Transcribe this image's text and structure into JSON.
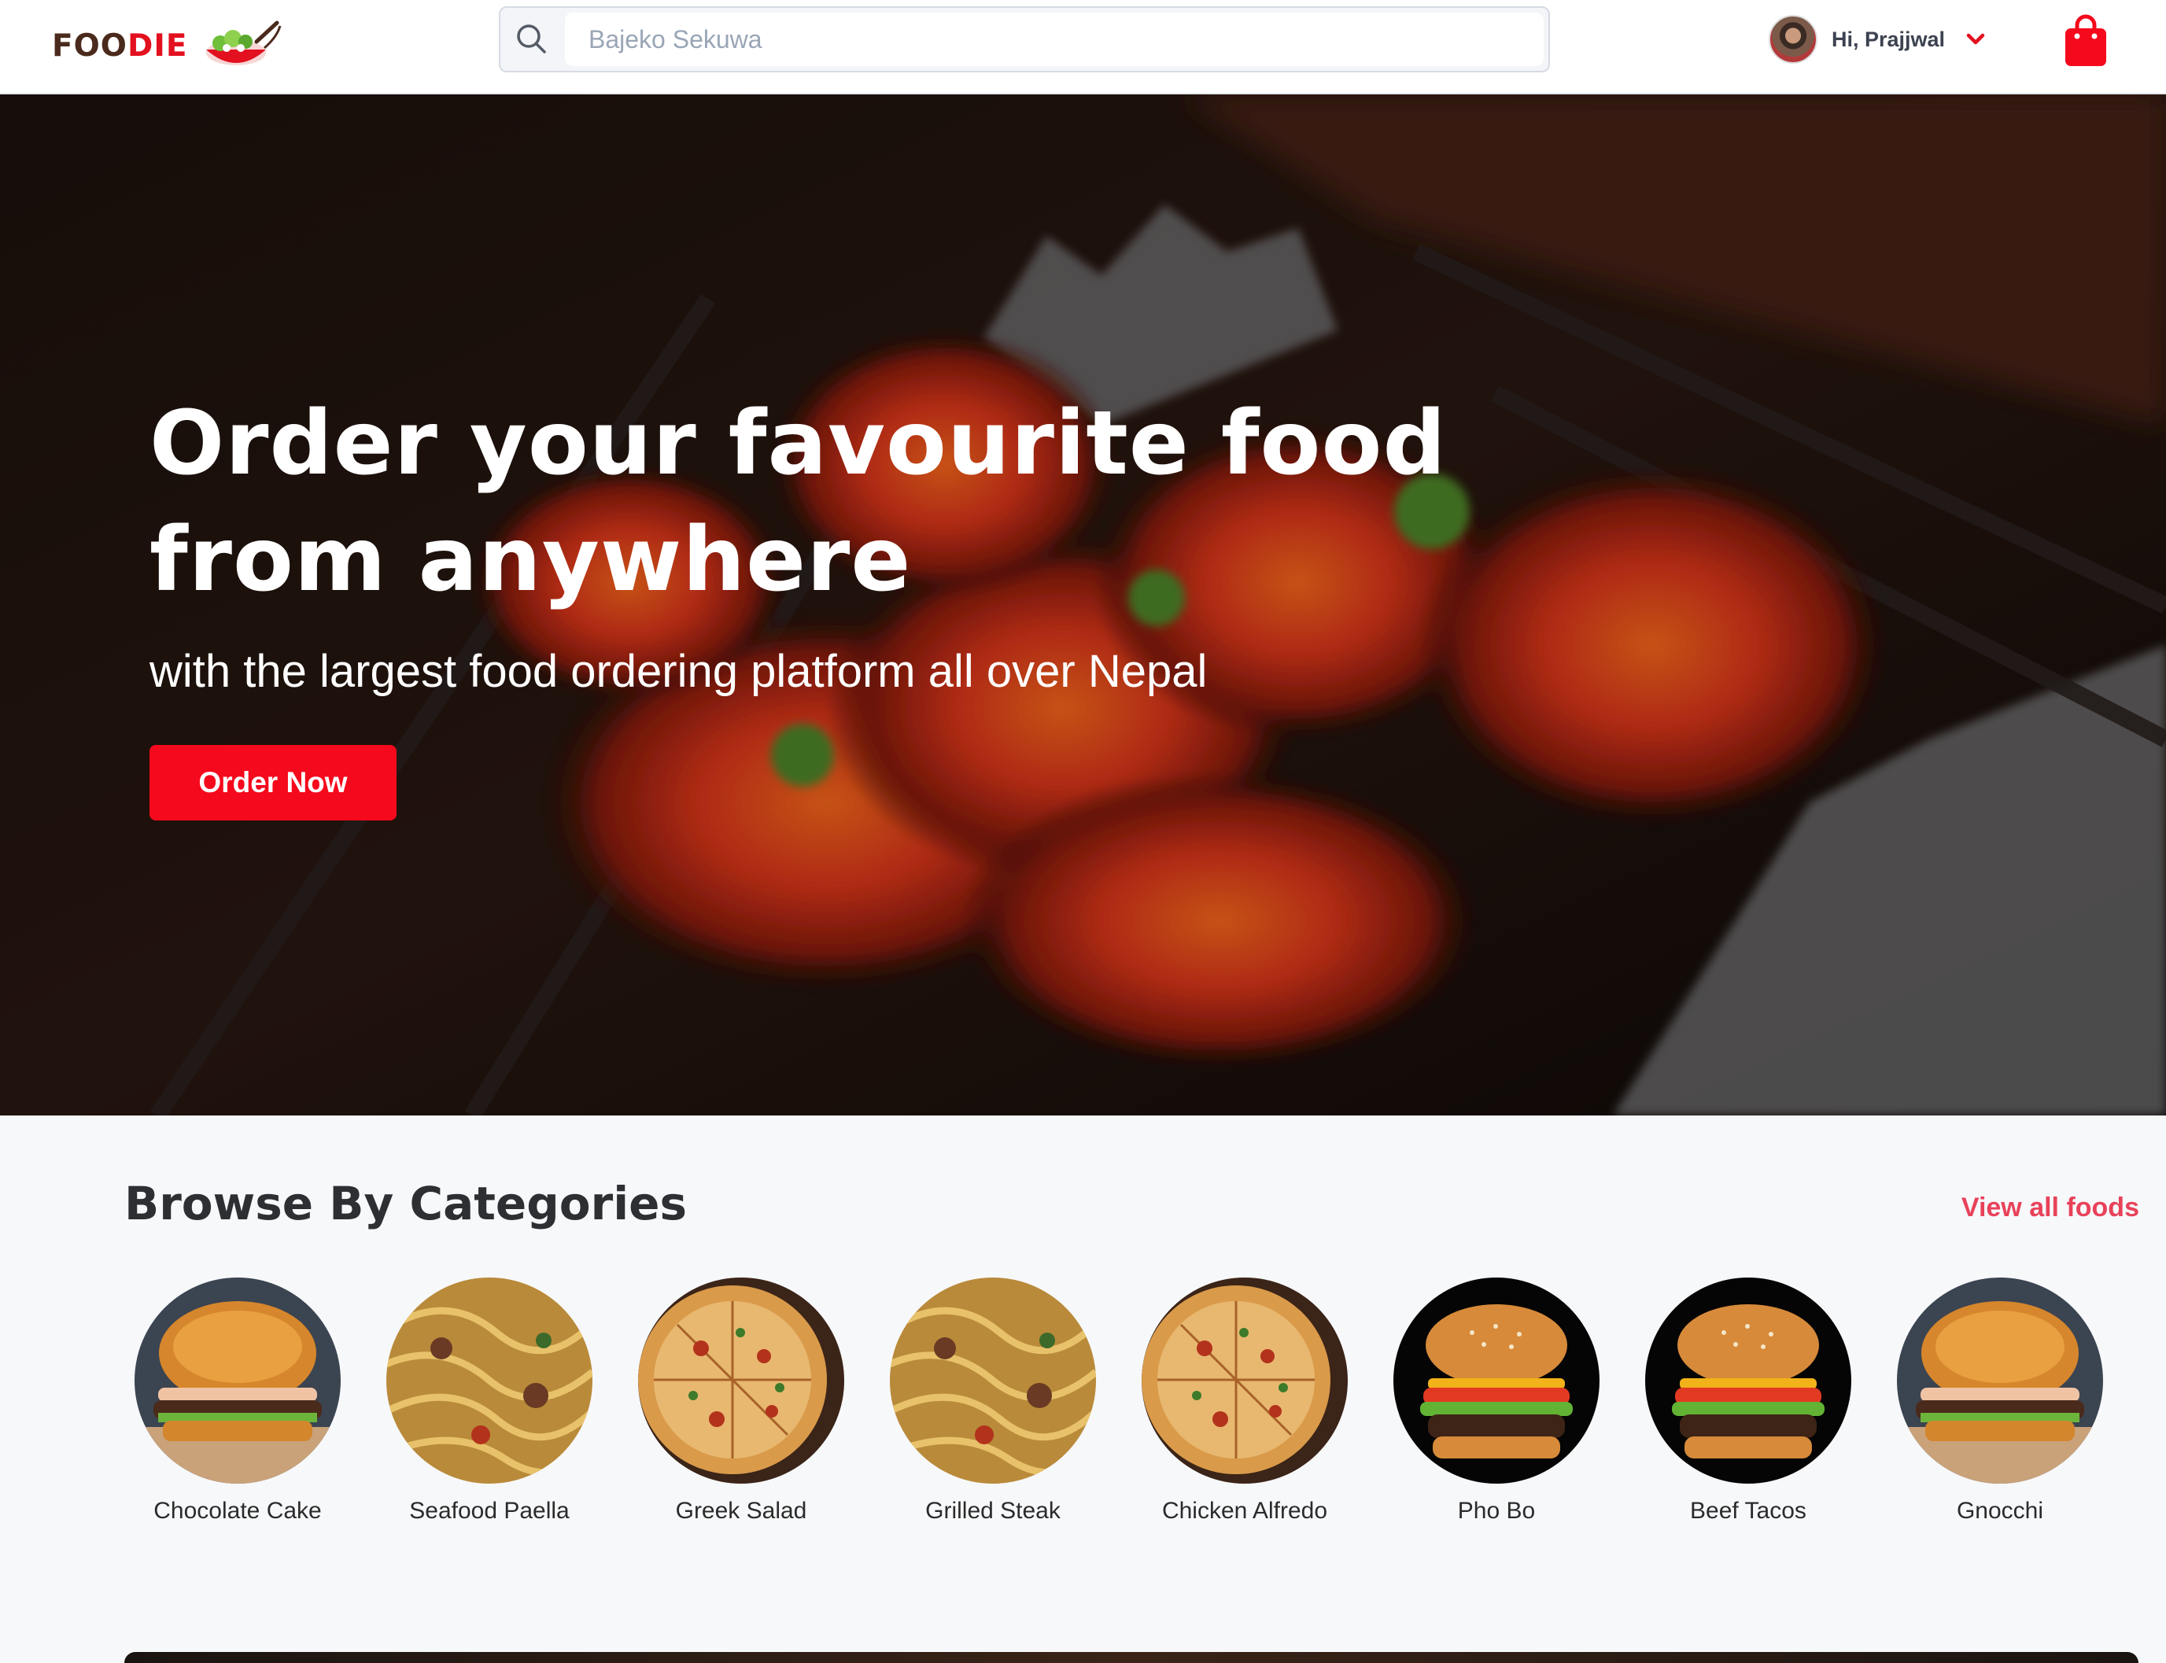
{
  "header": {
    "logo": {
      "text_dark": "FOO",
      "text_accent": "DIE"
    },
    "search": {
      "placeholder": "Bajeko Sekuwa"
    },
    "user": {
      "greeting": "Hi, Prajjwal"
    }
  },
  "hero": {
    "title_line1": "Order your favourite food",
    "title_line2": "from anywhere",
    "subtitle": "with the largest food ordering platform all over Nepal",
    "cta_label": "Order Now"
  },
  "categories": {
    "title": "Browse By Categories",
    "view_all_label": "View all foods",
    "items": [
      {
        "label": "Chocolate Cake",
        "image": "burger"
      },
      {
        "label": "Seafood Paella",
        "image": "pasta"
      },
      {
        "label": "Greek Salad",
        "image": "pizza"
      },
      {
        "label": "Grilled Steak",
        "image": "pasta"
      },
      {
        "label": "Chicken Alfredo",
        "image": "pizza"
      },
      {
        "label": "Pho Bo",
        "image": "burger-dark"
      },
      {
        "label": "Beef Tacos",
        "image": "burger-dark"
      },
      {
        "label": "Gnocchi",
        "image": "burger"
      }
    ]
  },
  "colors": {
    "brand_red": "#f5091c",
    "link_pink": "#e8425a",
    "logo_brown": "#4a2a1c"
  }
}
